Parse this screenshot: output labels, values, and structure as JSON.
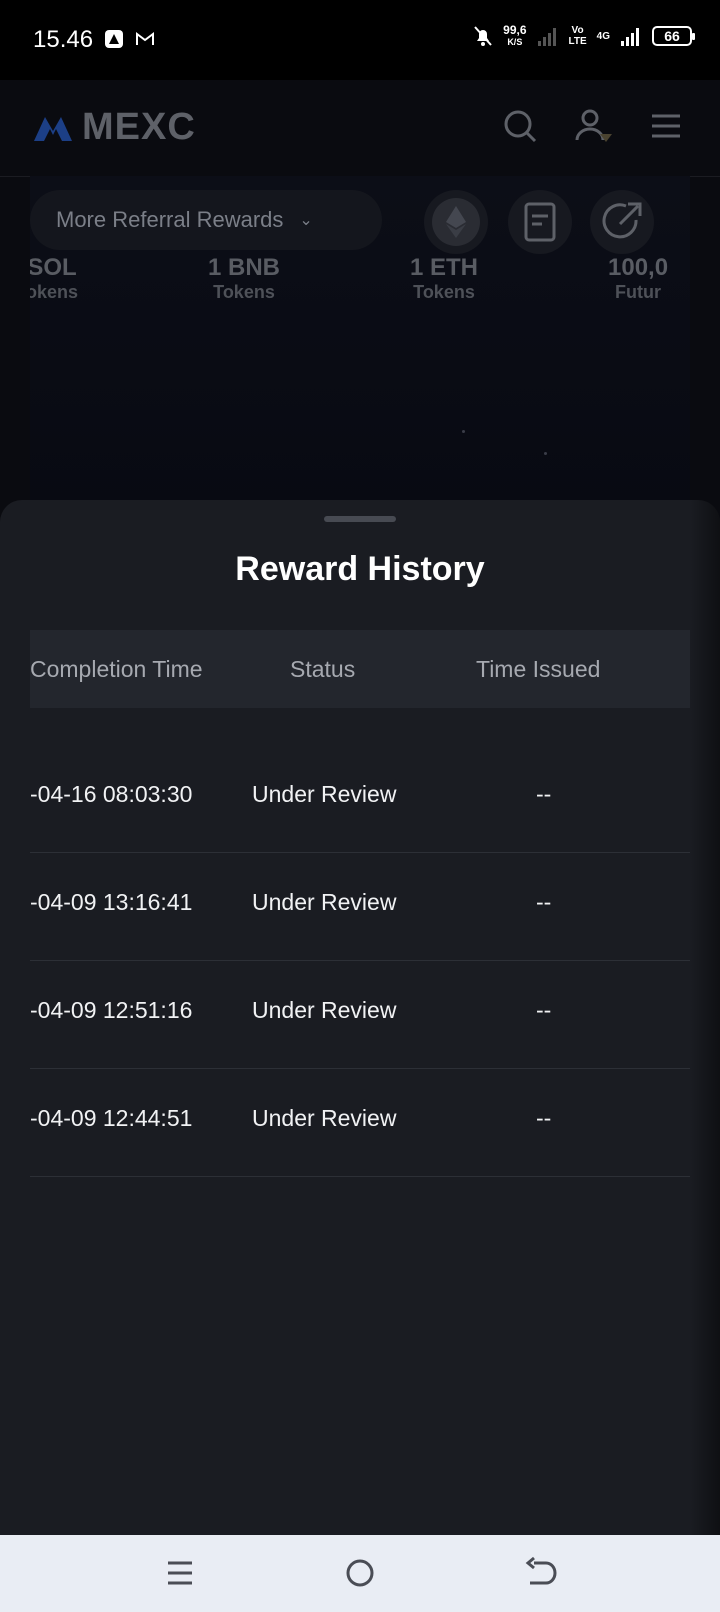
{
  "status_bar": {
    "time": "15.46",
    "net_speed": "99,6",
    "net_unit": "K/S",
    "volte": "Vo\nLTE",
    "network": "4G",
    "battery": "66"
  },
  "app": {
    "logo_text": "MEXC"
  },
  "banner": {
    "pill_label": "More Referral Rewards",
    "prizes": [
      {
        "amount": "SOL",
        "label": "okens"
      },
      {
        "amount": "1 BNB",
        "label": "Tokens"
      },
      {
        "amount": "1 ETH",
        "label": "Tokens"
      },
      {
        "amount": "100,0",
        "label": "Futur"
      }
    ]
  },
  "sheet": {
    "title": "Reward History",
    "columns": [
      "Completion Time",
      "Status",
      "Time Issued"
    ],
    "rows": [
      {
        "completion": "-04-16 08:03:30",
        "status": "Under Review",
        "issued": "--"
      },
      {
        "completion": "-04-09 13:16:41",
        "status": "Under Review",
        "issued": "--"
      },
      {
        "completion": "-04-09 12:51:16",
        "status": "Under Review",
        "issued": "--"
      },
      {
        "completion": "-04-09 12:44:51",
        "status": "Under Review",
        "issued": "--"
      }
    ]
  },
  "colors": {
    "sheet_bg": "#1a1c22",
    "header_bg": "#23262d",
    "navbar_bg": "#e9edf4"
  }
}
